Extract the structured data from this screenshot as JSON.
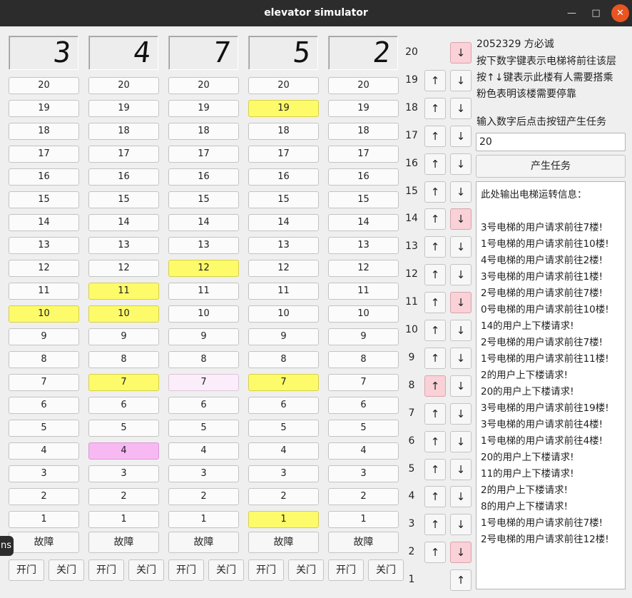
{
  "window": {
    "title": "elevator simulator"
  },
  "displays": [
    "3",
    "4",
    "7",
    "5",
    "2"
  ],
  "floors_desc": [
    "20",
    "19",
    "18",
    "17",
    "16",
    "15",
    "14",
    "13",
    "12",
    "11",
    "10",
    "9",
    "8",
    "7",
    "6",
    "5",
    "4",
    "3",
    "2",
    "1"
  ],
  "elevators": [
    {
      "highlights": {
        "10": "yellow"
      }
    },
    {
      "highlights": {
        "11": "yellow",
        "10": "yellow",
        "7": "yellow",
        "4": "pink"
      }
    },
    {
      "highlights": {
        "12": "yellow",
        "7": "lightpink"
      }
    },
    {
      "highlights": {
        "19": "yellow",
        "7": "yellow",
        "1": "yellow"
      }
    },
    {
      "highlights": {}
    }
  ],
  "fault_label": "故障",
  "open_label": "开门",
  "close_label": "关门",
  "hall": [
    {
      "floor": "20",
      "up": null,
      "down": "↓",
      "down_active": true
    },
    {
      "floor": "19",
      "up": "↑",
      "down": "↓"
    },
    {
      "floor": "18",
      "up": "↑",
      "down": "↓"
    },
    {
      "floor": "17",
      "up": "↑",
      "down": "↓"
    },
    {
      "floor": "16",
      "up": "↑",
      "down": "↓"
    },
    {
      "floor": "15",
      "up": "↑",
      "down": "↓"
    },
    {
      "floor": "14",
      "up": "↑",
      "down": "↓",
      "down_active": true
    },
    {
      "floor": "13",
      "up": "↑",
      "down": "↓"
    },
    {
      "floor": "12",
      "up": "↑",
      "down": "↓"
    },
    {
      "floor": "11",
      "up": "↑",
      "down": "↓",
      "down_active": true
    },
    {
      "floor": "10",
      "up": "↑",
      "down": "↓"
    },
    {
      "floor": "9",
      "up": "↑",
      "down": "↓"
    },
    {
      "floor": "8",
      "up": "↑",
      "down": "↓",
      "up_active": true
    },
    {
      "floor": "7",
      "up": "↑",
      "down": "↓"
    },
    {
      "floor": "6",
      "up": "↑",
      "down": "↓"
    },
    {
      "floor": "5",
      "up": "↑",
      "down": "↓"
    },
    {
      "floor": "4",
      "up": "↑",
      "down": "↓"
    },
    {
      "floor": "3",
      "up": "↑",
      "down": "↓"
    },
    {
      "floor": "2",
      "up": "↑",
      "down": "↓",
      "down_active": true
    },
    {
      "floor": "1",
      "up": null,
      "down": "↑"
    }
  ],
  "info": {
    "line1": "2052329 方必诚",
    "line2": "按下数字键表示电梯将前往该层",
    "line3": "按↑↓键表示此楼有人需要搭乘",
    "line4": "粉色表明该楼需要停靠",
    "prompt": "输入数字后点击按钮产生任务"
  },
  "task_input": {
    "value": "20"
  },
  "generate_label": "产生任务",
  "log": {
    "header": "此处输出电梯运转信息：",
    "lines": [
      "3号电梯的用户请求前往7楼!",
      "1号电梯的用户请求前往10楼!",
      "4号电梯的用户请求前往2楼!",
      "3号电梯的用户请求前往1楼!",
      "2号电梯的用户请求前往7楼!",
      "0号电梯的用户请求前往10楼!",
      "14的用户上下楼请求!",
      "2号电梯的用户请求前往7楼!",
      "1号电梯的用户请求前往11楼!",
      "2的用户上下楼请求!",
      "20的用户上下楼请求!",
      "3号电梯的用户请求前往19楼!",
      "3号电梯的用户请求前往4楼!",
      "1号电梯的用户请求前往4楼!",
      "20的用户上下楼请求!",
      "11的用户上下楼请求!",
      "2的用户上下楼请求!",
      "8的用户上下楼请求!",
      "1号电梯的用户请求前往7楼!",
      "2号电梯的用户请求前往12楼!"
    ]
  },
  "tooltip": "ns"
}
